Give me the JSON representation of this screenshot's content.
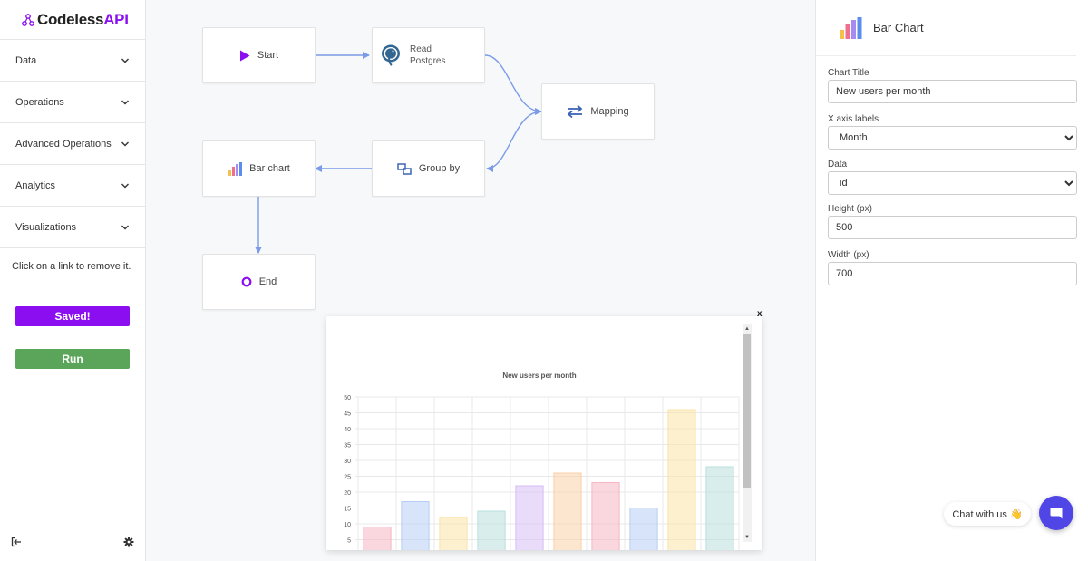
{
  "app": {
    "logo_main": "Codeless",
    "logo_accent": "API"
  },
  "sidebar": {
    "items": [
      {
        "label": "Data"
      },
      {
        "label": "Operations"
      },
      {
        "label": "Advanced Operations"
      },
      {
        "label": "Analytics"
      },
      {
        "label": "Visualizations"
      }
    ],
    "hint": "Click on a link to remove it.",
    "saved_label": "Saved!",
    "run_label": "Run"
  },
  "flow": {
    "nodes": {
      "start": "Start",
      "read_line1": "Read",
      "read_line2": "Postgres",
      "mapping": "Mapping",
      "groupby": "Group by",
      "barchart": "Bar chart",
      "end": "End"
    }
  },
  "popup": {
    "close_label": "x"
  },
  "chart_data": {
    "type": "bar",
    "title": "New users per month",
    "values": [
      9,
      17,
      12,
      14,
      22,
      26,
      23,
      15,
      46,
      28
    ],
    "colors": [
      "#f6b6c2",
      "#b6cdf4",
      "#fbe3a8",
      "#b9e0dc",
      "#d7bdf6",
      "#f9d2a8",
      "#f6b6c2",
      "#b6cdf4",
      "#fbe3a8",
      "#b9e0dc"
    ],
    "y_ticks": [
      "5",
      "10",
      "15",
      "20",
      "25",
      "30",
      "35",
      "40",
      "45",
      "50"
    ],
    "ylim": [
      0,
      50
    ],
    "grid": true
  },
  "panel": {
    "title": "Bar Chart",
    "chart_title_label": "Chart Title",
    "chart_title_value": "New users per month",
    "x_axis_label": "X axis labels",
    "x_axis_value": "Month",
    "data_label": "Data",
    "data_value": "id",
    "height_label": "Height (px)",
    "height_value": "500",
    "width_label": "Width (px)",
    "width_value": "700"
  },
  "chat": {
    "label": "Chat with us 👋"
  }
}
